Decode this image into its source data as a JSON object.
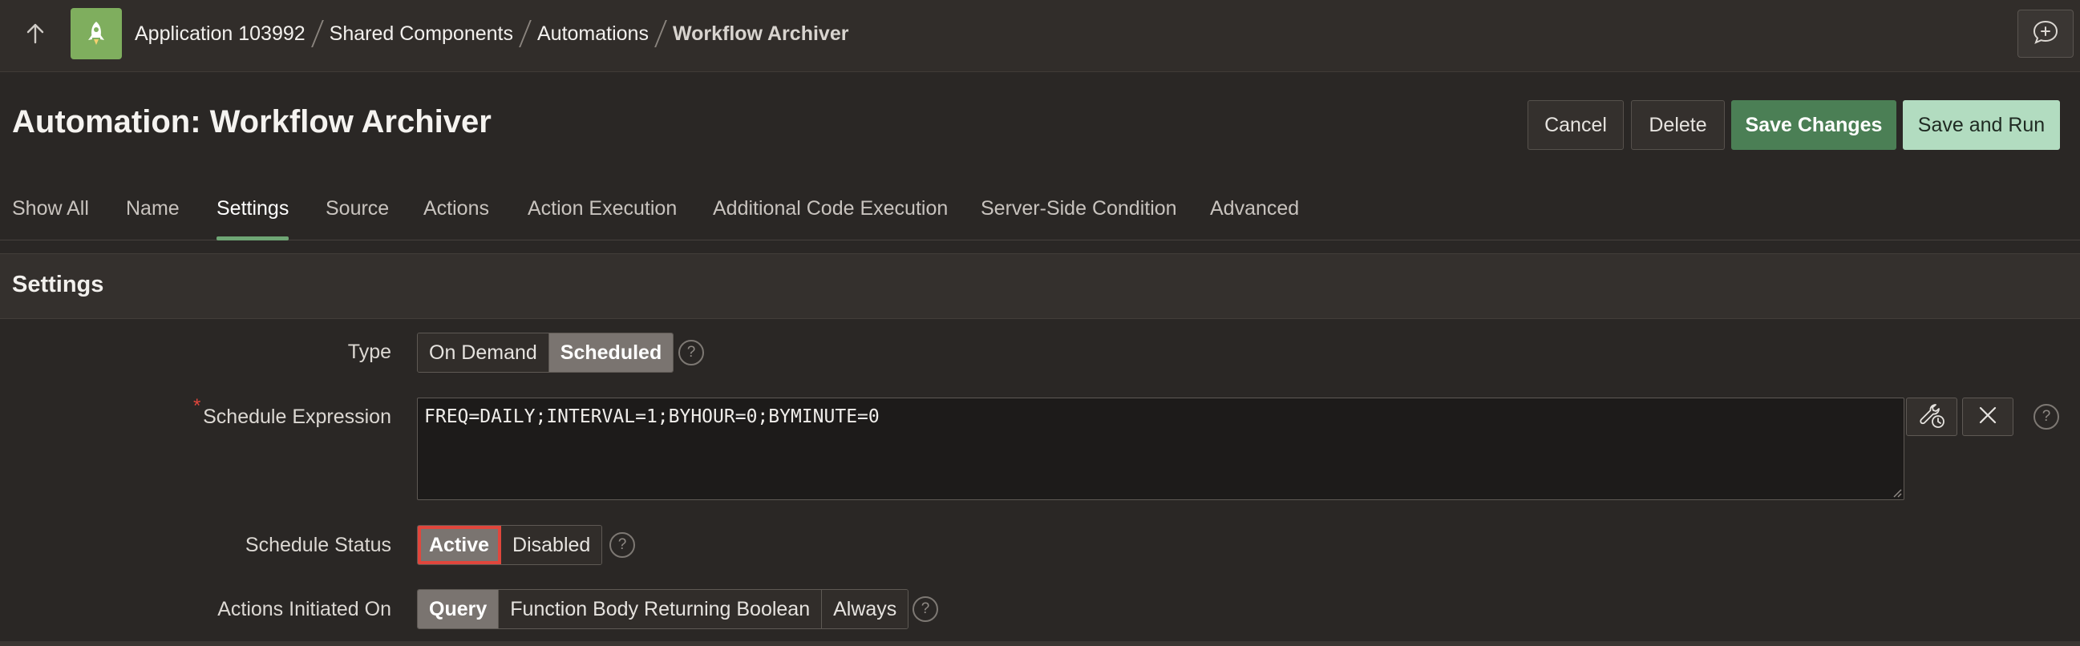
{
  "topbar": {
    "up_icon": "arrow-up-icon",
    "app_icon": "rocket-icon",
    "breadcrumb": [
      "Application 103992",
      "Shared Components",
      "Automations",
      "Workflow Archiver"
    ],
    "feedback_icon": "feedback-chat-icon"
  },
  "header": {
    "title": "Automation: Workflow Archiver",
    "buttons": {
      "cancel": "Cancel",
      "delete": "Delete",
      "save": "Save Changes",
      "save_run": "Save and Run"
    }
  },
  "tabs": [
    "Show All",
    "Name",
    "Settings",
    "Source",
    "Actions",
    "Action Execution",
    "Additional Code Execution",
    "Server-Side Condition",
    "Advanced"
  ],
  "active_tab": "Settings",
  "settings": {
    "region_title": "Settings",
    "type": {
      "label": "Type",
      "options": [
        "On Demand",
        "Scheduled"
      ],
      "selected": "Scheduled"
    },
    "schedule_expression": {
      "label": "Schedule Expression",
      "required_marker": "*",
      "value": "FREQ=DAILY;INTERVAL=1;BYHOUR=0;BYMINUTE=0",
      "builder_icon": "wrench-clock-icon",
      "clear_icon": "close-icon"
    },
    "schedule_status": {
      "label": "Schedule Status",
      "options": [
        "Active",
        "Disabled"
      ],
      "selected": "Active"
    },
    "actions_initiated_on": {
      "label": "Actions Initiated On",
      "options": [
        "Query",
        "Function Body Returning Boolean",
        "Always"
      ],
      "selected": "Query"
    },
    "help_glyph": "?"
  },
  "colors": {
    "background": "#2a2725",
    "primary_button": "#4b7f55",
    "secondary_success_button": "#b2dcc0",
    "active_tab_underline": "#6fa675",
    "focus_outline": "#e0463c",
    "app_icon_bg": "#7fae5e"
  }
}
